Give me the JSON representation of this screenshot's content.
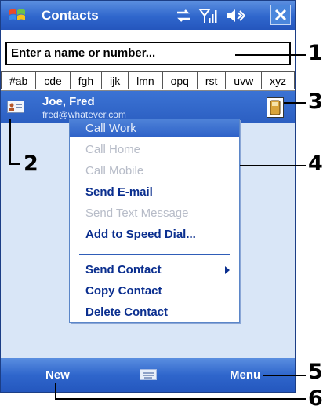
{
  "window": {
    "title": "Contacts",
    "close_label": "✕"
  },
  "search": {
    "placeholder": "Enter a name or number..."
  },
  "alpha_tabs": [
    "#ab",
    "cde",
    "fgh",
    "ijk",
    "lmn",
    "opq",
    "rst",
    "uvw",
    "xyz"
  ],
  "contact": {
    "name": "Joe, Fred",
    "email": "fred@whatever.com"
  },
  "context_menu": {
    "items": [
      {
        "label": "Call Work",
        "enabled": false
      },
      {
        "label": "Call Home",
        "enabled": false
      },
      {
        "label": "Call Mobile",
        "enabled": false
      },
      {
        "label": "Send E-mail",
        "enabled": true
      },
      {
        "label": "Send Text Message",
        "enabled": false
      },
      {
        "label": "Add to Speed Dial...",
        "enabled": true
      },
      {
        "label": "Send Contact",
        "enabled": true
      },
      {
        "label": "Copy Contact",
        "enabled": true
      },
      {
        "label": "Delete Contact",
        "enabled": true
      }
    ]
  },
  "menubar": {
    "left_softkey": "New",
    "right_softkey": "Menu"
  },
  "callouts": [
    "1",
    "2",
    "3",
    "4",
    "5",
    "6"
  ],
  "colors": {
    "titlebar": "#2f66cc",
    "selection": "#2c5fc2",
    "menu_text": "#0b2f8f",
    "disabled_text": "#b7bcc8"
  }
}
